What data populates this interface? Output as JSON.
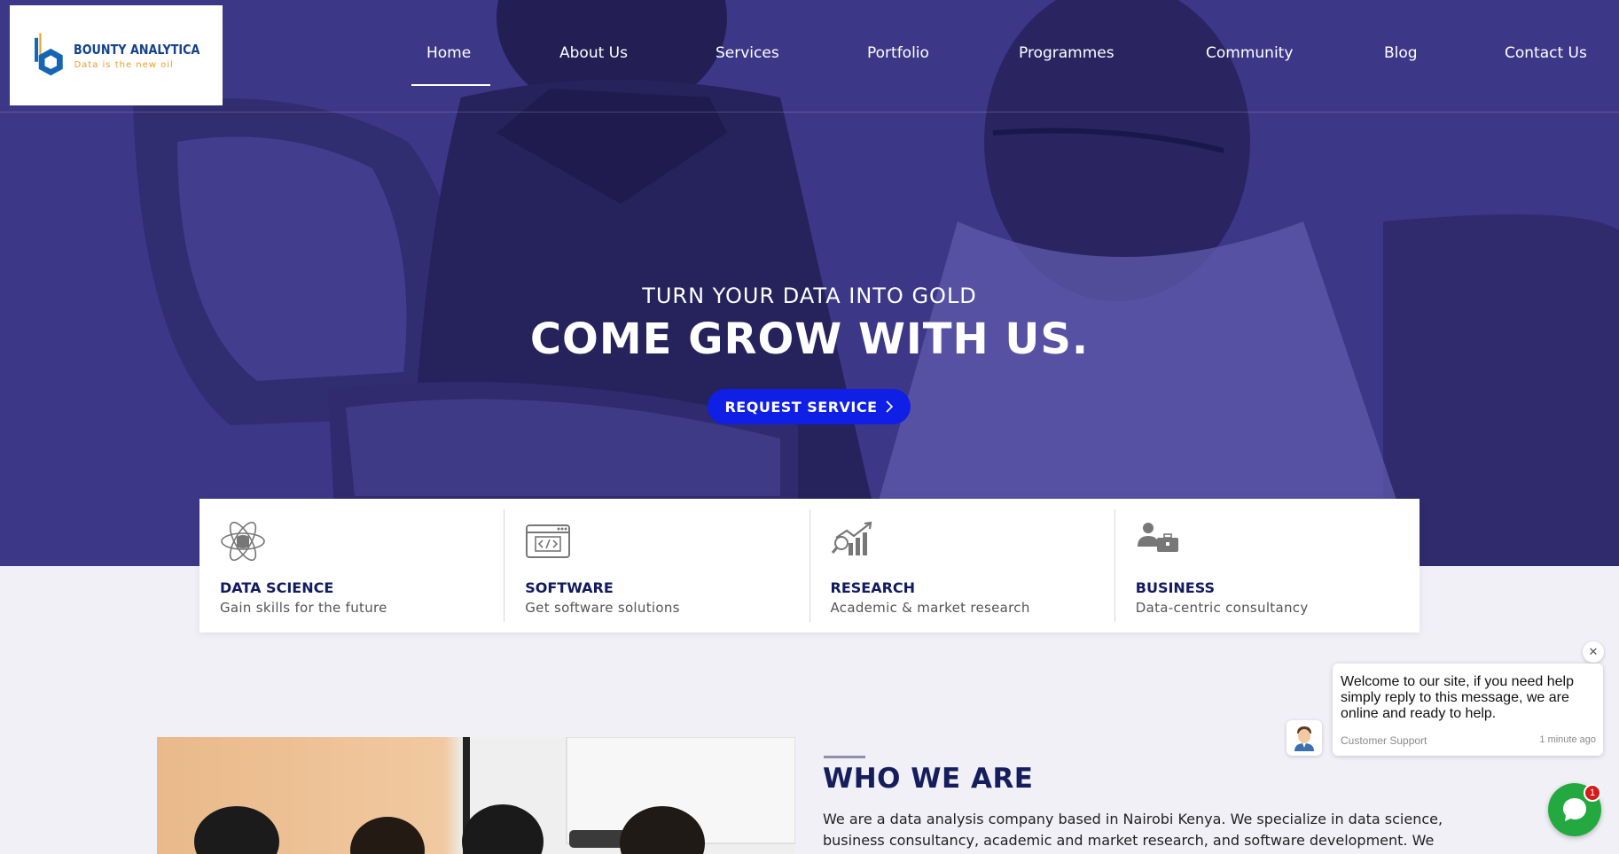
{
  "brand": {
    "name": "BOUNTY ANALYTICA",
    "tagline": "Data is the new oil"
  },
  "nav": {
    "items": [
      {
        "label": "Home",
        "active": true
      },
      {
        "label": "About Us"
      },
      {
        "label": "Services"
      },
      {
        "label": "Portfolio"
      },
      {
        "label": "Programmes"
      },
      {
        "label": "Community"
      },
      {
        "label": "Blog"
      },
      {
        "label": "Contact Us"
      }
    ]
  },
  "hero": {
    "subtitle": "TURN YOUR DATA INTO GOLD",
    "title": "COME GROW WITH US.",
    "cta": "REQUEST SERVICE",
    "overlay_color": "#3b3685"
  },
  "features": [
    {
      "icon": "atom-data-icon",
      "title": "DATA SCIENCE",
      "subtitle": "Gain skills for the future"
    },
    {
      "icon": "code-window-icon",
      "title": "SOFTWARE",
      "subtitle": "Get software solutions"
    },
    {
      "icon": "research-chart-icon",
      "title": "RESEARCH",
      "subtitle": "Academic & market research"
    },
    {
      "icon": "business-person-icon",
      "title": "BUSINESS",
      "subtitle": "Data-centric consultancy"
    }
  ],
  "about": {
    "title": "WHO WE ARE",
    "text": "We are a data analysis company based in Nairobi Kenya. We specialize in data science, business consultancy, academic and market research, and software development. We"
  },
  "chat": {
    "message": "Welcome to our site, if you need help simply reply to this message, we are online and ready to help.",
    "from": "Customer Support",
    "time": "1 minute ago",
    "badge": "1",
    "close": "✕"
  },
  "colors": {
    "accent": "#0f1fe6",
    "navy": "#121a60",
    "chat_green": "#24a940"
  }
}
